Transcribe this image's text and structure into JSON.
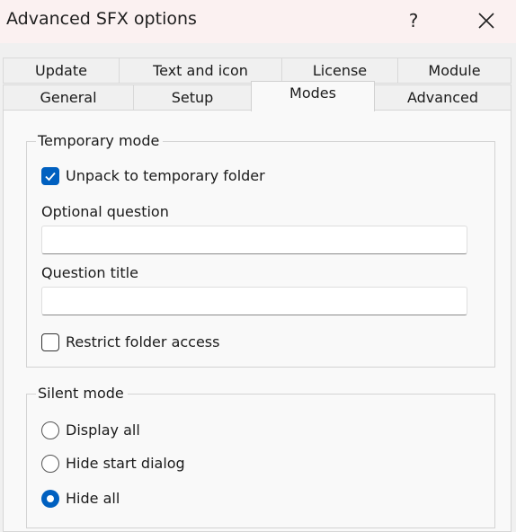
{
  "window": {
    "title": "Advanced SFX options",
    "help_label": "?",
    "close_label": "✕"
  },
  "tabs": {
    "row1": [
      "Update",
      "Text and icon",
      "License",
      "Module"
    ],
    "row2": [
      "General",
      "Setup",
      "Modes",
      "Advanced"
    ],
    "active": "Modes"
  },
  "temporary_mode": {
    "legend": "Temporary mode",
    "unpack": {
      "label": "Unpack to temporary folder",
      "checked": true
    },
    "optional_question": {
      "label": "Optional question",
      "value": ""
    },
    "question_title": {
      "label": "Question title",
      "value": ""
    },
    "restrict": {
      "label": "Restrict folder access",
      "checked": false
    }
  },
  "silent_mode": {
    "legend": "Silent mode",
    "options": [
      "Display all",
      "Hide start dialog",
      "Hide all"
    ],
    "selected": "Hide all"
  },
  "colors": {
    "accent": "#0060c0",
    "titlebar": "#fbf1f1",
    "panel": "#f9f9f9"
  },
  "icons": {
    "help": "question-mark-icon",
    "close": "close-icon",
    "check": "checkmark-icon"
  }
}
